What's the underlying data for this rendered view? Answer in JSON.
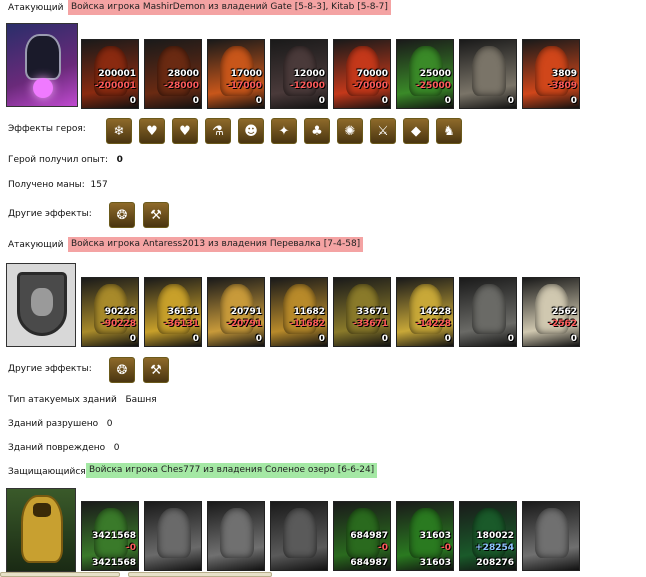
{
  "section1": {
    "role": "Атакующий",
    "banner": "Войска игрока MashirDemon из владений Gate [5-8-3], Kitab [5-8-7]",
    "units": [
      {
        "count": "200001",
        "loss": "-200001",
        "rest": "0",
        "color": "#8a2a10"
      },
      {
        "count": "28000",
        "loss": "-28000",
        "rest": "0",
        "color": "#6a2a12"
      },
      {
        "count": "17000",
        "loss": "-17000",
        "rest": "0",
        "color": "#c8561a"
      },
      {
        "count": "12000",
        "loss": "-12000",
        "rest": "0",
        "color": "#4a3a3a"
      },
      {
        "count": "70000",
        "loss": "-70000",
        "rest": "0",
        "color": "#c4381a"
      },
      {
        "count": "25000",
        "loss": "-25000",
        "rest": "0",
        "color": "#3a8a28"
      },
      {
        "count": "",
        "loss": "",
        "rest": "0",
        "color": "#7a7468"
      },
      {
        "count": "3809",
        "loss": "-3809",
        "rest": "0",
        "color": "#d0461a"
      }
    ],
    "hero_effects_label": "Эффекты героя:",
    "hero_effects": [
      "❄",
      "♥",
      "♥",
      "⚗",
      "☻",
      "✦",
      "♣",
      "✺",
      "⚔",
      "◆",
      "♞"
    ],
    "exp_label": "Герой получил опыт:",
    "exp_value": "0",
    "mana_label": "Получено маны:",
    "mana_value": "157",
    "other_effects_label": "Другие эффекты:",
    "other_effects": [
      "❂",
      "⚒"
    ]
  },
  "section2": {
    "role": "Атакующий",
    "banner": "Войска игрока Antaress2013 из владения Перевалка [7-4-58]",
    "units": [
      {
        "count": "90228",
        "loss": "-90228",
        "rest": "0",
        "color": "#a88a2a"
      },
      {
        "count": "36131",
        "loss": "-36131",
        "rest": "0",
        "color": "#c8a02a"
      },
      {
        "count": "20791",
        "loss": "-20791",
        "rest": "0",
        "color": "#c89a3a"
      },
      {
        "count": "11682",
        "loss": "-11682",
        "rest": "0",
        "color": "#b88a2a"
      },
      {
        "count": "33671",
        "loss": "-33671",
        "rest": "0",
        "color": "#8a7a2a"
      },
      {
        "count": "14228",
        "loss": "-14228",
        "rest": "0",
        "color": "#c8a838"
      },
      {
        "count": "",
        "loss": "",
        "rest": "0",
        "color": "#6a6a66"
      },
      {
        "count": "2562",
        "loss": "-2562",
        "rest": "0",
        "color": "#d0c8b0"
      }
    ],
    "other_effects_label": "Другие эффекты:",
    "other_effects": [
      "❂",
      "⚒"
    ],
    "building_type_label": "Тип атакуемых зданий",
    "building_type_value": "Башня",
    "destroyed_label": "Зданий разрушено",
    "destroyed_value": "0",
    "damaged_label": "Зданий повреждено",
    "damaged_value": "0"
  },
  "section3": {
    "role": "Защищающийся",
    "banner": "Войска игрока Ches777 из владения Соленое озеро [6-6-24]",
    "units": [
      {
        "count": "3421568",
        "loss": "-0",
        "rest": "3421568",
        "color": "#3a7a2a",
        "gain": false
      },
      {
        "count": "",
        "loss": "",
        "rest": "",
        "color": "#6a6a6a",
        "gain": false
      },
      {
        "count": "",
        "loss": "",
        "rest": "",
        "color": "#707070",
        "gain": false
      },
      {
        "count": "",
        "loss": "",
        "rest": "",
        "color": "#5a5a5a",
        "gain": false
      },
      {
        "count": "684987",
        "loss": "-0",
        "rest": "684987",
        "color": "#2a6a1e",
        "gain": false
      },
      {
        "count": "31603",
        "loss": "-0",
        "rest": "31603",
        "color": "#2a7a20",
        "gain": false
      },
      {
        "count": "180022",
        "loss": "+28254",
        "rest": "208276",
        "color": "#1a5a2a",
        "gain": true
      },
      {
        "count": "",
        "loss": "",
        "rest": "",
        "color": "#707070",
        "gain": false
      }
    ]
  }
}
